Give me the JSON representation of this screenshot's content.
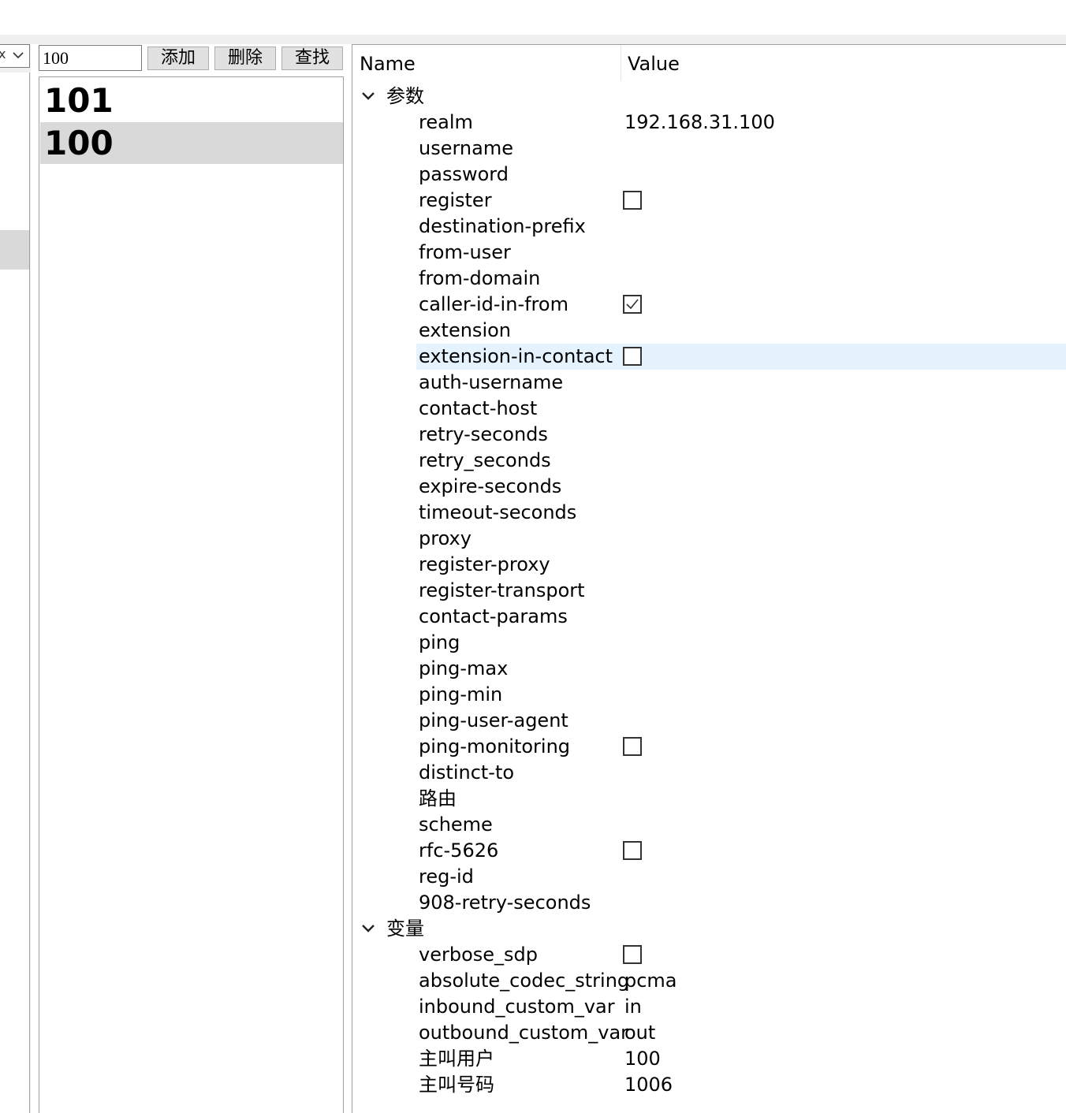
{
  "left": {
    "combo_text": "x",
    "combo_icon": "chevron-down-icon"
  },
  "toolbar": {
    "search_value": "100",
    "add_label": "添加",
    "delete_label": "删除",
    "find_label": "查找"
  },
  "list": {
    "items": [
      {
        "label": "101",
        "selected": false
      },
      {
        "label": "100",
        "selected": true
      }
    ]
  },
  "grid": {
    "header_name": "Name",
    "header_value": "Value",
    "groups": [
      {
        "label": "参数",
        "rows": [
          {
            "name": "realm",
            "value": "192.168.31.100"
          },
          {
            "name": "username",
            "value": ""
          },
          {
            "name": "password",
            "value": ""
          },
          {
            "name": "register",
            "checkbox": true,
            "checked": false
          },
          {
            "name": "destination-prefix",
            "value": ""
          },
          {
            "name": "from-user",
            "value": ""
          },
          {
            "name": "from-domain",
            "value": ""
          },
          {
            "name": "caller-id-in-from",
            "checkbox": true,
            "checked": true
          },
          {
            "name": "extension",
            "value": ""
          },
          {
            "name": "extension-in-contact",
            "checkbox": true,
            "checked": false,
            "highlighted": true
          },
          {
            "name": "auth-username",
            "value": ""
          },
          {
            "name": "contact-host",
            "value": ""
          },
          {
            "name": "retry-seconds",
            "value": ""
          },
          {
            "name": "retry_seconds",
            "value": ""
          },
          {
            "name": "expire-seconds",
            "value": ""
          },
          {
            "name": "timeout-seconds",
            "value": ""
          },
          {
            "name": "proxy",
            "value": ""
          },
          {
            "name": "register-proxy",
            "value": ""
          },
          {
            "name": "register-transport",
            "value": ""
          },
          {
            "name": "contact-params",
            "value": ""
          },
          {
            "name": "ping",
            "value": ""
          },
          {
            "name": "ping-max",
            "value": ""
          },
          {
            "name": "ping-min",
            "value": ""
          },
          {
            "name": "ping-user-agent",
            "value": ""
          },
          {
            "name": "ping-monitoring",
            "checkbox": true,
            "checked": false
          },
          {
            "name": "distinct-to",
            "value": ""
          },
          {
            "name": "路由",
            "value": ""
          },
          {
            "name": "scheme",
            "value": ""
          },
          {
            "name": "rfc-5626",
            "checkbox": true,
            "checked": false
          },
          {
            "name": "reg-id",
            "value": ""
          },
          {
            "name": "908-retry-seconds",
            "value": ""
          }
        ]
      },
      {
        "label": "变量",
        "rows": [
          {
            "name": "verbose_sdp",
            "checkbox": true,
            "checked": false
          },
          {
            "name": "absolute_codec_string",
            "value": "pcma"
          },
          {
            "name": "inbound_custom_var",
            "value": "in"
          },
          {
            "name": "outbound_custom_var",
            "value": "out"
          },
          {
            "name": "主叫用户",
            "value": "100"
          },
          {
            "name": "主叫号码",
            "value": "1006"
          }
        ]
      }
    ]
  }
}
